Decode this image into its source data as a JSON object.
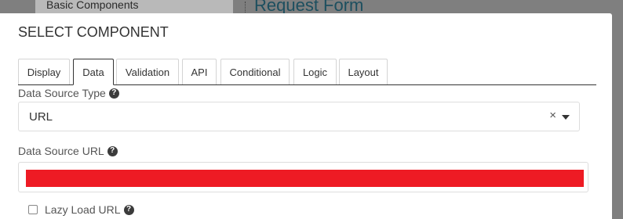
{
  "background": {
    "sidebar_item": "Basic Components",
    "form_title": "Request Form"
  },
  "modal": {
    "title": "SELECT COMPONENT"
  },
  "tabs": [
    {
      "label": "Display",
      "active": false
    },
    {
      "label": "Data",
      "active": true
    },
    {
      "label": "Validation",
      "active": false
    },
    {
      "label": "API",
      "active": false
    },
    {
      "label": "Conditional",
      "active": false
    },
    {
      "label": "Logic",
      "active": false
    },
    {
      "label": "Layout",
      "active": false
    }
  ],
  "data_source_type": {
    "label": "Data Source Type",
    "value": "URL",
    "clear_icon": "×",
    "help_icon": "?"
  },
  "data_source_url": {
    "label": "Data Source URL",
    "value": "",
    "redacted": true,
    "redaction_color": "#ee1b24",
    "help_icon": "?"
  },
  "lazy_load": {
    "label": "Lazy Load URL",
    "checked": false,
    "help_icon": "?"
  }
}
